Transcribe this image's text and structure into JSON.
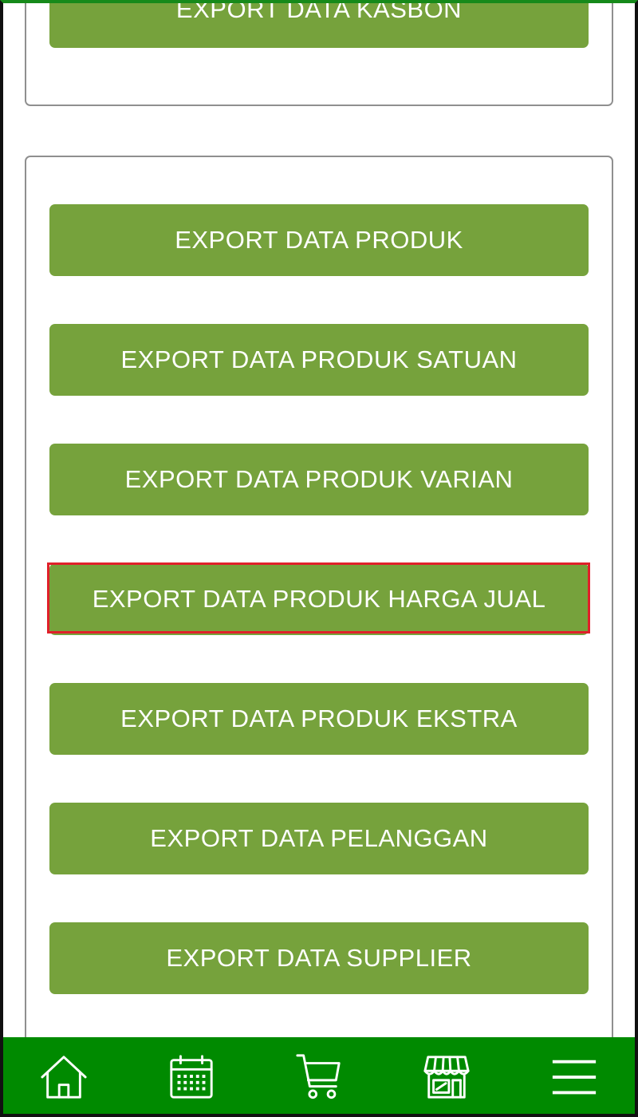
{
  "top_card": {
    "partial_button_label": "EXPORT DATA KASBON"
  },
  "export_buttons": [
    {
      "label": "EXPORT DATA PRODUK"
    },
    {
      "label": "EXPORT DATA PRODUK SATUAN"
    },
    {
      "label": "EXPORT DATA PRODUK VARIAN"
    },
    {
      "label": "EXPORT DATA PRODUK HARGA JUAL",
      "highlighted": true
    },
    {
      "label": "EXPORT DATA PRODUK EKSTRA"
    },
    {
      "label": "EXPORT DATA PELANGGAN"
    },
    {
      "label": "EXPORT DATA SUPPLIER"
    }
  ],
  "bottom_nav": [
    {
      "icon": "home-icon"
    },
    {
      "icon": "calendar-icon"
    },
    {
      "icon": "cart-icon"
    },
    {
      "icon": "store-icon"
    },
    {
      "icon": "menu-icon"
    }
  ],
  "colors": {
    "button_green": "#76a23c",
    "nav_green": "#008a00",
    "highlight_red": "#e0202a"
  }
}
